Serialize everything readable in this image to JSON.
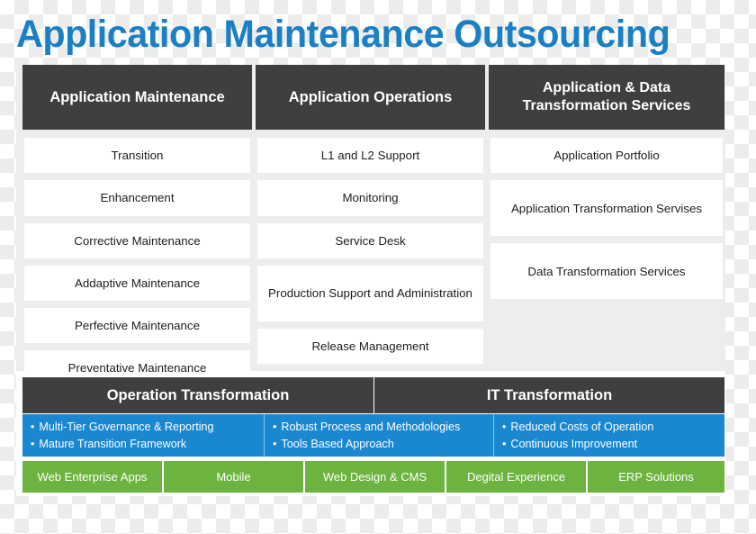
{
  "title": "Application Maintenance Outsourcing",
  "colors": {
    "title": "#1b7fc4",
    "header_dark": "#3f3f3f",
    "blue_panel": "#1a87d1",
    "green_panel": "#6cb33f",
    "panel_bg": "#ededed"
  },
  "columns": [
    {
      "header": "Application Maintenance",
      "items": [
        "Transition",
        "Enhancement",
        "Corrective Maintenance",
        "Addaptive Maintenance",
        "Perfective Maintenance",
        "Preventative Maintenance"
      ]
    },
    {
      "header": "Application Operations",
      "items": [
        "L1 and L2 Support",
        "Monitoring",
        "Service Desk",
        "Production Support and Administration",
        "Release Management"
      ]
    },
    {
      "header_line1": "Application & Data",
      "header_line2": "Transformation Services",
      "items": [
        "Application Portfolio",
        "Application Transformation Servises",
        "Data Transformation Services"
      ]
    }
  ],
  "transformation_bars": [
    "Operation Transformation",
    "IT Transformation"
  ],
  "blue_panels": [
    {
      "bullets": [
        "Multi-Tier Governance & Reporting",
        "Mature Transition Framework"
      ]
    },
    {
      "bullets": [
        "Robust Process and Methodologies",
        "Tools Based Approach"
      ]
    },
    {
      "bullets": [
        "Reduced Costs of Operation",
        "Continuous Improvement"
      ]
    }
  ],
  "green_items": [
    "Web Enterprise Apps",
    "Mobile",
    "Web Design & CMS",
    "Degital Experience",
    "ERP Solutions"
  ]
}
